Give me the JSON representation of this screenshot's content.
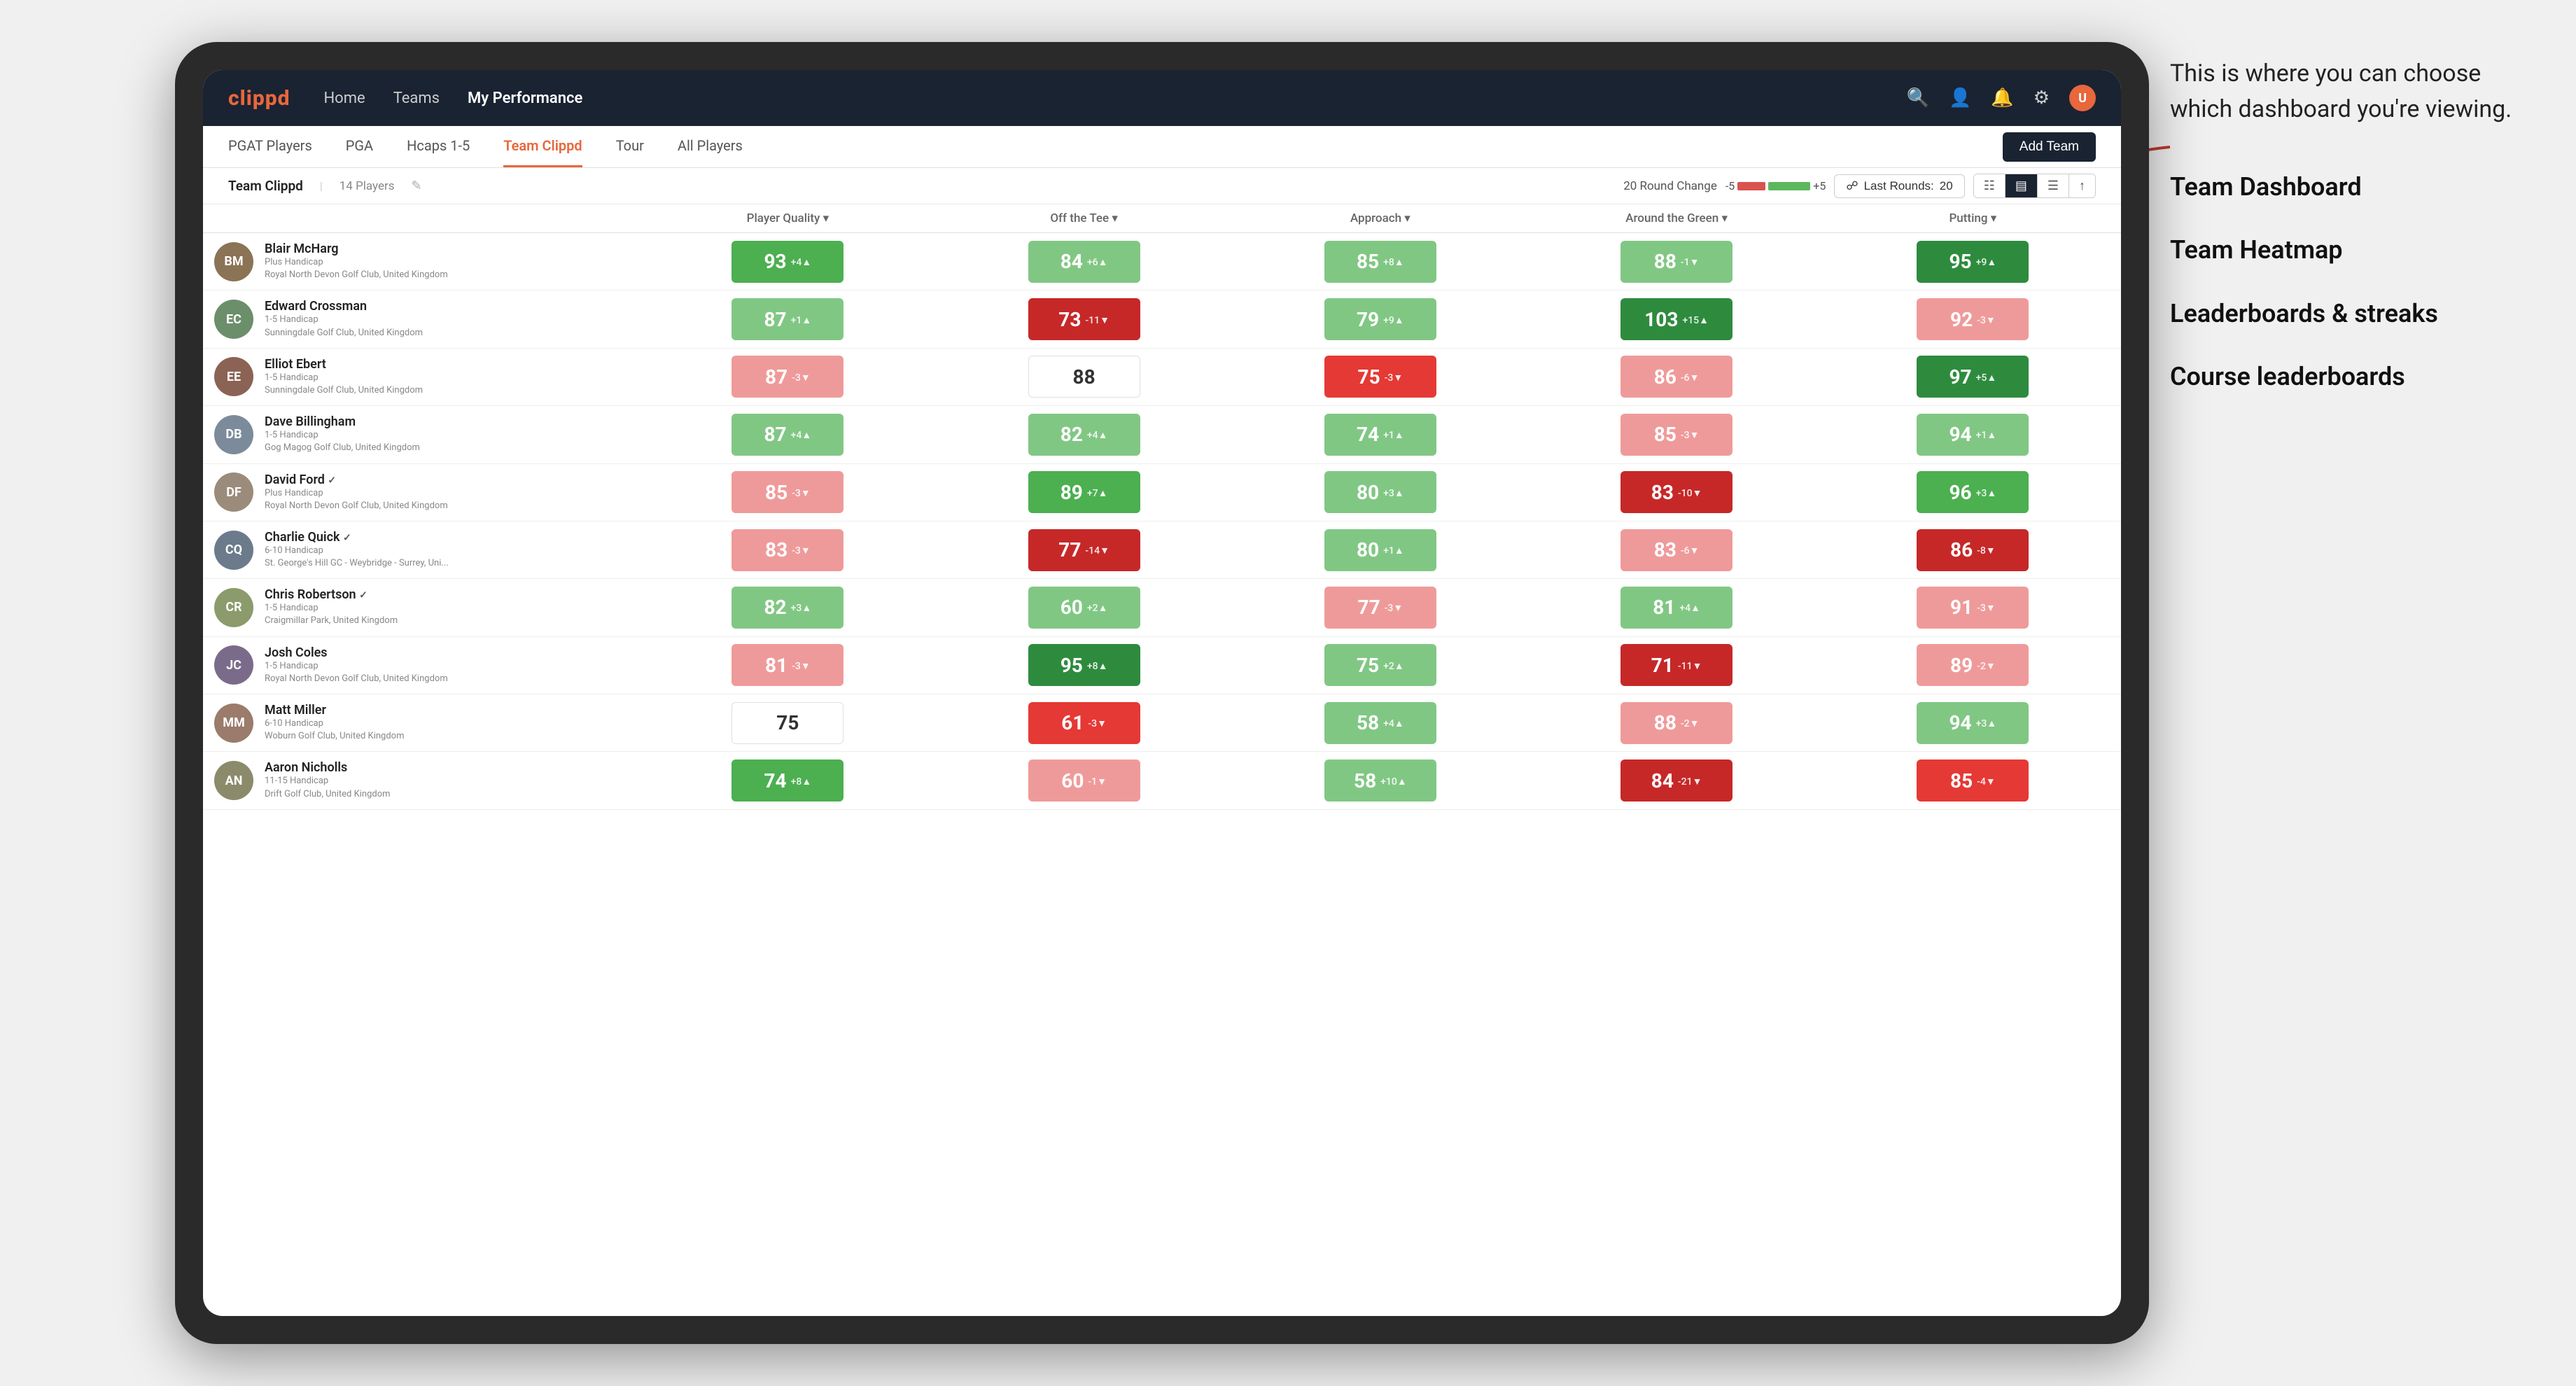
{
  "annotation": {
    "intro": "This is where you can choose which dashboard you're viewing.",
    "items": [
      "Team Dashboard",
      "Team Heatmap",
      "Leaderboards & streaks",
      "Course leaderboards"
    ]
  },
  "nav": {
    "logo": "clippd",
    "links": [
      {
        "label": "Home",
        "active": false
      },
      {
        "label": "Teams",
        "active": false
      },
      {
        "label": "My Performance",
        "active": true
      }
    ],
    "icons": [
      "search",
      "person",
      "bell",
      "settings",
      "avatar"
    ]
  },
  "sub_nav": {
    "links": [
      {
        "label": "PGAT Players",
        "active": false
      },
      {
        "label": "PGA",
        "active": false
      },
      {
        "label": "Hcaps 1-5",
        "active": false
      },
      {
        "label": "Team Clippd",
        "active": true
      },
      {
        "label": "Tour",
        "active": false
      },
      {
        "label": "All Players",
        "active": false
      }
    ],
    "add_team_label": "Add Team"
  },
  "team_header": {
    "name": "Team Clippd",
    "separator": "|",
    "count": "14 Players",
    "round_change_label": "20 Round Change",
    "round_change_neg": "-5",
    "round_change_pos": "+5",
    "last_rounds_label": "Last Rounds:",
    "last_rounds_value": "20"
  },
  "table": {
    "columns": [
      {
        "label": "Player Quality ▾",
        "key": "quality"
      },
      {
        "label": "Off the Tee ▾",
        "key": "tee"
      },
      {
        "label": "Approach ▾",
        "key": "approach"
      },
      {
        "label": "Around the Green ▾",
        "key": "green"
      },
      {
        "label": "Putting ▾",
        "key": "putting"
      }
    ],
    "players": [
      {
        "name": "Blair McHarg",
        "handicap": "Plus Handicap",
        "club": "Royal North Devon Golf Club, United Kingdom",
        "avatar_color": "#8B7355",
        "quality": {
          "value": 93,
          "change": "+4",
          "dir": "up",
          "color": "green-mid"
        },
        "tee": {
          "value": 84,
          "change": "+6",
          "dir": "up",
          "color": "green-light"
        },
        "approach": {
          "value": 85,
          "change": "+8",
          "dir": "up",
          "color": "green-light"
        },
        "green": {
          "value": 88,
          "change": "-1",
          "dir": "down",
          "color": "green-light"
        },
        "putting": {
          "value": 95,
          "change": "+9",
          "dir": "up",
          "color": "green-dark"
        }
      },
      {
        "name": "Edward Crossman",
        "handicap": "1-5 Handicap",
        "club": "Sunningdale Golf Club, United Kingdom",
        "avatar_color": "#6B8E6B",
        "quality": {
          "value": 87,
          "change": "+1",
          "dir": "up",
          "color": "green-light"
        },
        "tee": {
          "value": 73,
          "change": "-11",
          "dir": "down",
          "color": "red-dark"
        },
        "approach": {
          "value": 79,
          "change": "+9",
          "dir": "up",
          "color": "green-light"
        },
        "green": {
          "value": 103,
          "change": "+15",
          "dir": "up",
          "color": "green-dark"
        },
        "putting": {
          "value": 92,
          "change": "-3",
          "dir": "down",
          "color": "red-light"
        }
      },
      {
        "name": "Elliot Ebert",
        "handicap": "1-5 Handicap",
        "club": "Sunningdale Golf Club, United Kingdom",
        "avatar_color": "#8B6355",
        "quality": {
          "value": 87,
          "change": "-3",
          "dir": "down",
          "color": "red-light"
        },
        "tee": {
          "value": 88,
          "change": "",
          "dir": "",
          "color": "white"
        },
        "approach": {
          "value": 75,
          "change": "-3",
          "dir": "down",
          "color": "red-mid"
        },
        "green": {
          "value": 86,
          "change": "-6",
          "dir": "down",
          "color": "red-light"
        },
        "putting": {
          "value": 97,
          "change": "+5",
          "dir": "up",
          "color": "green-dark"
        }
      },
      {
        "name": "Dave Billingham",
        "handicap": "1-5 Handicap",
        "club": "Gog Magog Golf Club, United Kingdom",
        "avatar_color": "#7B8B9B",
        "quality": {
          "value": 87,
          "change": "+4",
          "dir": "up",
          "color": "green-light"
        },
        "tee": {
          "value": 82,
          "change": "+4",
          "dir": "up",
          "color": "green-light"
        },
        "approach": {
          "value": 74,
          "change": "+1",
          "dir": "up",
          "color": "green-light"
        },
        "green": {
          "value": 85,
          "change": "-3",
          "dir": "down",
          "color": "red-light"
        },
        "putting": {
          "value": 94,
          "change": "+1",
          "dir": "up",
          "color": "green-light"
        }
      },
      {
        "name": "David Ford",
        "handicap": "Plus Handicap",
        "club": "Royal North Devon Golf Club, United Kingdom",
        "has_check": true,
        "avatar_color": "#9B8B7B",
        "quality": {
          "value": 85,
          "change": "-3",
          "dir": "down",
          "color": "red-light"
        },
        "tee": {
          "value": 89,
          "change": "+7",
          "dir": "up",
          "color": "green-mid"
        },
        "approach": {
          "value": 80,
          "change": "+3",
          "dir": "up",
          "color": "green-light"
        },
        "green": {
          "value": 83,
          "change": "-10",
          "dir": "down",
          "color": "red-dark"
        },
        "putting": {
          "value": 96,
          "change": "+3",
          "dir": "up",
          "color": "green-mid"
        }
      },
      {
        "name": "Charlie Quick",
        "handicap": "6-10 Handicap",
        "club": "St. George's Hill GC - Weybridge - Surrey, Uni...",
        "has_check": true,
        "avatar_color": "#6B7B8B",
        "quality": {
          "value": 83,
          "change": "-3",
          "dir": "down",
          "color": "red-light"
        },
        "tee": {
          "value": 77,
          "change": "-14",
          "dir": "down",
          "color": "red-dark"
        },
        "approach": {
          "value": 80,
          "change": "+1",
          "dir": "up",
          "color": "green-light"
        },
        "green": {
          "value": 83,
          "change": "-6",
          "dir": "down",
          "color": "red-light"
        },
        "putting": {
          "value": 86,
          "change": "-8",
          "dir": "down",
          "color": "red-dark"
        }
      },
      {
        "name": "Chris Robertson",
        "handicap": "1-5 Handicap",
        "club": "Craigmillar Park, United Kingdom",
        "has_check": true,
        "avatar_color": "#8B9B6B",
        "quality": {
          "value": 82,
          "change": "+3",
          "dir": "up",
          "color": "green-light"
        },
        "tee": {
          "value": 60,
          "change": "+2",
          "dir": "up",
          "color": "green-light"
        },
        "approach": {
          "value": 77,
          "change": "-3",
          "dir": "down",
          "color": "red-light"
        },
        "green": {
          "value": 81,
          "change": "+4",
          "dir": "up",
          "color": "green-light"
        },
        "putting": {
          "value": 91,
          "change": "-3",
          "dir": "down",
          "color": "red-light"
        }
      },
      {
        "name": "Josh Coles",
        "handicap": "1-5 Handicap",
        "club": "Royal North Devon Golf Club, United Kingdom",
        "avatar_color": "#7B6B8B",
        "quality": {
          "value": 81,
          "change": "-3",
          "dir": "down",
          "color": "red-light"
        },
        "tee": {
          "value": 95,
          "change": "+8",
          "dir": "up",
          "color": "green-dark"
        },
        "approach": {
          "value": 75,
          "change": "+2",
          "dir": "up",
          "color": "green-light"
        },
        "green": {
          "value": 71,
          "change": "-11",
          "dir": "down",
          "color": "red-dark"
        },
        "putting": {
          "value": 89,
          "change": "-2",
          "dir": "down",
          "color": "red-light"
        }
      },
      {
        "name": "Matt Miller",
        "handicap": "6-10 Handicap",
        "club": "Woburn Golf Club, United Kingdom",
        "avatar_color": "#9B7B6B",
        "quality": {
          "value": 75,
          "change": "",
          "dir": "",
          "color": "white"
        },
        "tee": {
          "value": 61,
          "change": "-3",
          "dir": "down",
          "color": "red-mid"
        },
        "approach": {
          "value": 58,
          "change": "+4",
          "dir": "up",
          "color": "green-light"
        },
        "green": {
          "value": 88,
          "change": "-2",
          "dir": "down",
          "color": "red-light"
        },
        "putting": {
          "value": 94,
          "change": "+3",
          "dir": "up",
          "color": "green-light"
        }
      },
      {
        "name": "Aaron Nicholls",
        "handicap": "11-15 Handicap",
        "club": "Drift Golf Club, United Kingdom",
        "avatar_color": "#8B8B6B",
        "quality": {
          "value": 74,
          "change": "+8",
          "dir": "up",
          "color": "green-mid"
        },
        "tee": {
          "value": 60,
          "change": "-1",
          "dir": "down",
          "color": "red-light"
        },
        "approach": {
          "value": 58,
          "change": "+10",
          "dir": "up",
          "color": "green-light"
        },
        "green": {
          "value": 84,
          "change": "-21",
          "dir": "down",
          "color": "red-dark"
        },
        "putting": {
          "value": 85,
          "change": "-4",
          "dir": "down",
          "color": "red-mid"
        }
      }
    ]
  }
}
